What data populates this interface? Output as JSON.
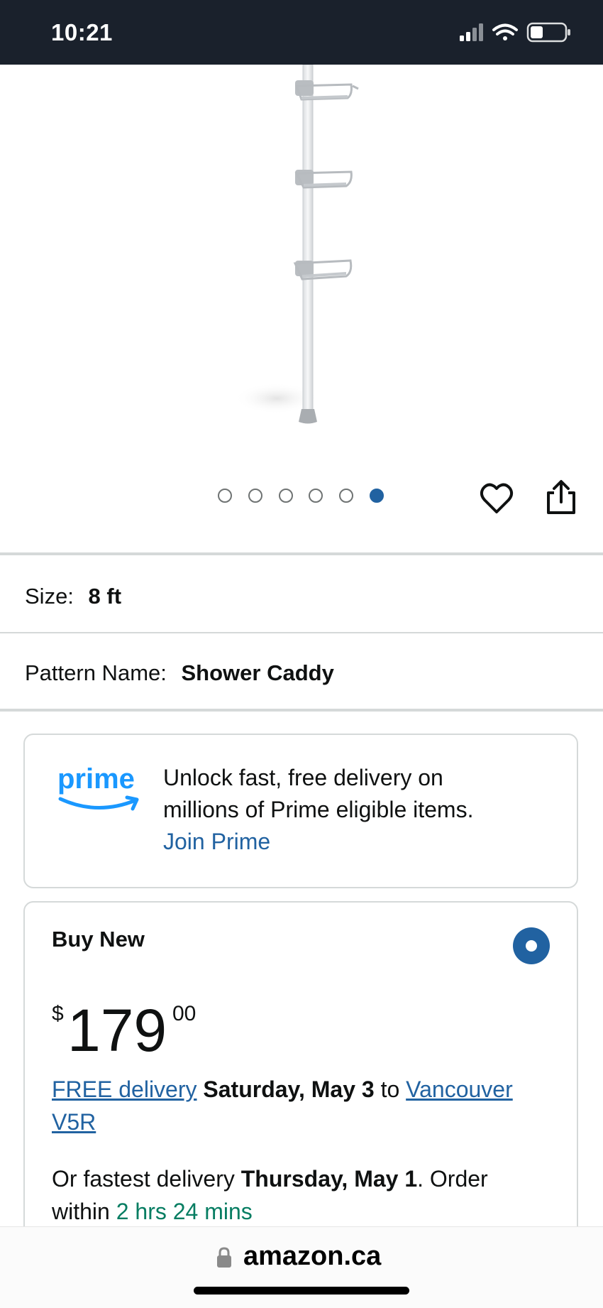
{
  "status_bar": {
    "time": "10:21",
    "signal_icon": "signal-icon",
    "wifi_icon": "wifi-icon",
    "battery_icon": "battery-icon"
  },
  "product_image": {
    "description_icon": "shower-caddy-pole-image",
    "slide_count": 6,
    "active_slide": 6
  },
  "actions": {
    "wishlist_icon": "heart-icon",
    "share_icon": "share-icon"
  },
  "size": {
    "label": "Size:",
    "value": "8 ft"
  },
  "pattern": {
    "label": "Pattern Name:",
    "value": "Shower Caddy"
  },
  "prime": {
    "logo_text": "prime",
    "line1": "Unlock fast, free delivery on",
    "line2": "millions of Prime eligible items.",
    "join_link": "Join Prime"
  },
  "buy_new": {
    "title": "Buy New",
    "selected": true,
    "price_symbol": "$",
    "price_whole": "179",
    "price_fraction": "00",
    "delivery_link": "FREE delivery",
    "delivery_date": "Saturday, May 3",
    "to_word": "to",
    "location_link": "Vancouver V5R",
    "fastest_prefix": "Or fastest delivery",
    "fastest_date": "Thursday, May 1",
    "order_within_text": ". Order within",
    "countdown": "2 hrs 24 mins"
  },
  "url_bar": {
    "domain": "amazon.ca"
  },
  "colors": {
    "accent": "#2162a1",
    "status_bar": "#1a212c",
    "prime_blue": "#1a98ff",
    "green": "#067d62"
  }
}
